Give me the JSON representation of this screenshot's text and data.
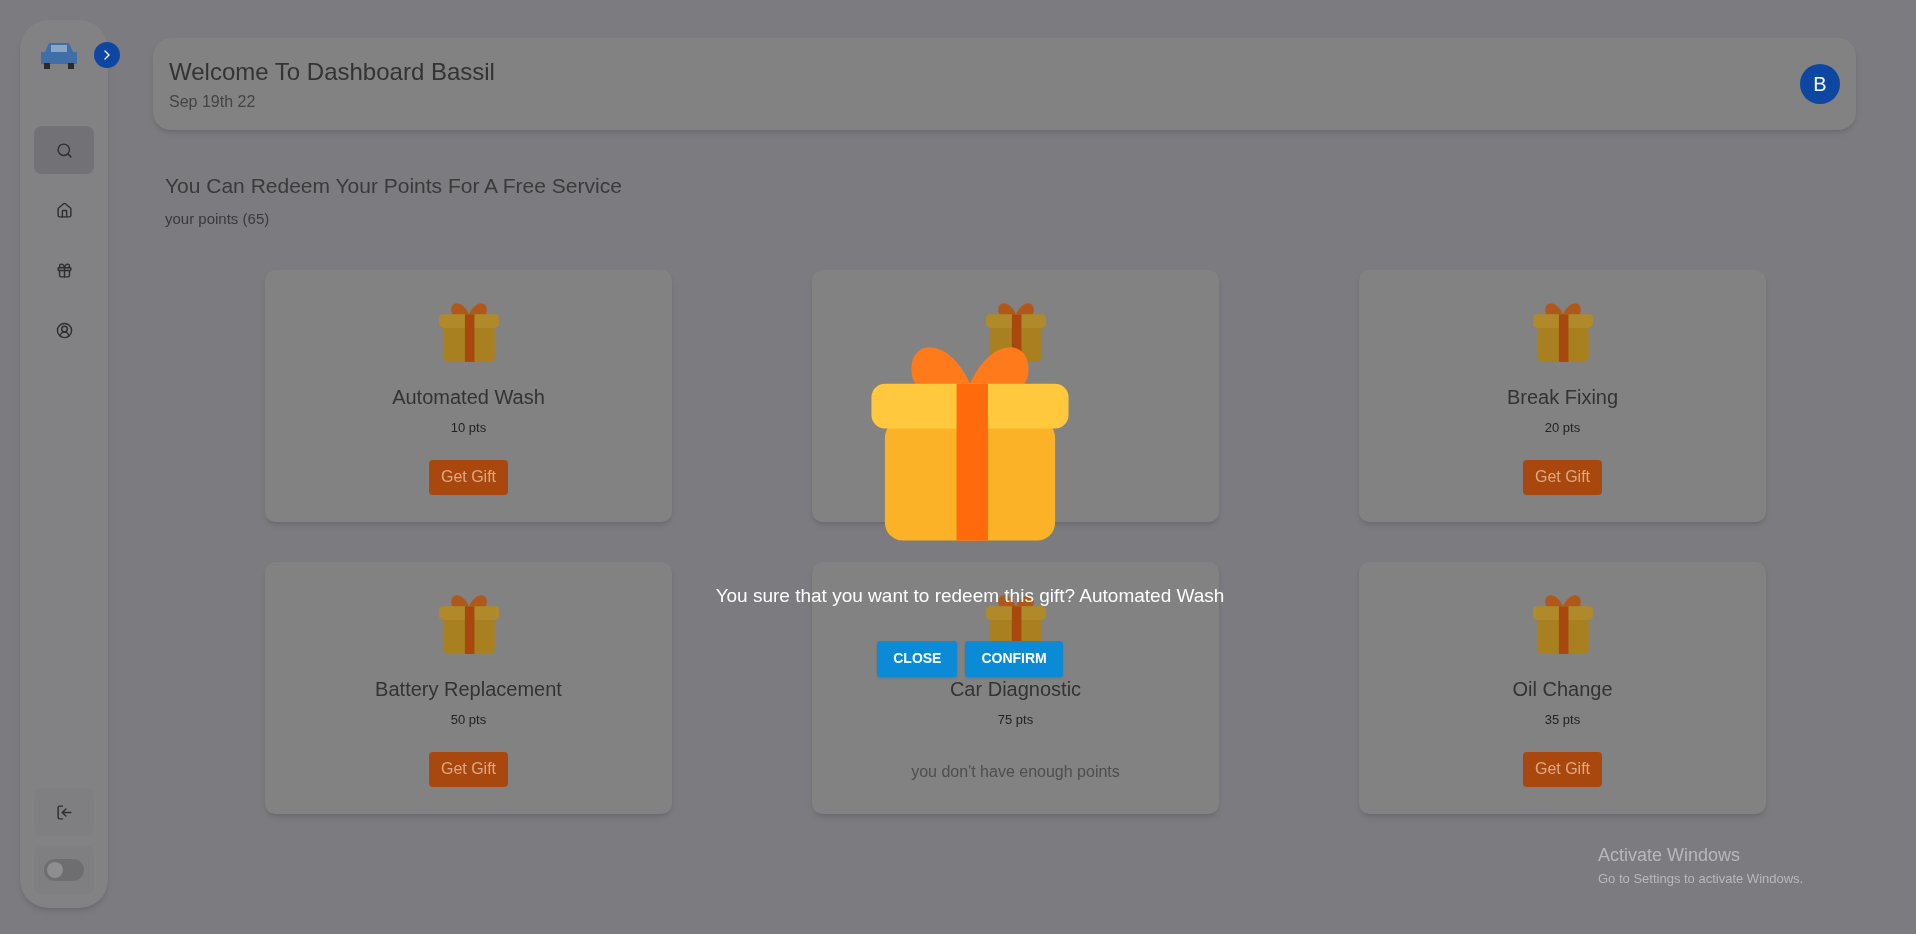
{
  "sidebar": {
    "items": [
      {
        "kind": "search",
        "selected": true
      },
      {
        "kind": "home",
        "selected": false
      },
      {
        "kind": "gift",
        "selected": false
      },
      {
        "kind": "user",
        "selected": false
      }
    ],
    "theme_toggle": {
      "on": false
    }
  },
  "header": {
    "title": "Welcome To Dashboard Bassil",
    "date": "Sep 19th 22",
    "avatar": "B"
  },
  "heading": "You Can Redeem Your Points For A Free Service",
  "points": "your points (65)",
  "cards": [
    {
      "kind": "available",
      "title": "Automated Wash",
      "pts": "10 pts",
      "action": "Get Gift"
    },
    {
      "kind": "covered"
    },
    {
      "kind": "available",
      "title": "Break Fixing",
      "pts": "20 pts",
      "action": "Get Gift"
    },
    {
      "kind": "available",
      "title": "Battery Replacement",
      "pts": "50 pts",
      "action": "Get Gift"
    },
    {
      "kind": "locked",
      "title": "Car Diagnostic",
      "pts": "75 pts",
      "note": "you don't have enough points"
    },
    {
      "kind": "available",
      "title": "Oil Change",
      "pts": "35 pts",
      "action": "Get Gift"
    }
  ],
  "dialog": {
    "message": "You sure that you want to redeem this gift? Automated Wash",
    "buttons": [
      "CLOSE",
      "CONFIRM"
    ]
  },
  "os_notice": {
    "title": "Activate Windows",
    "text": "Go to Settings to activate Windows."
  }
}
